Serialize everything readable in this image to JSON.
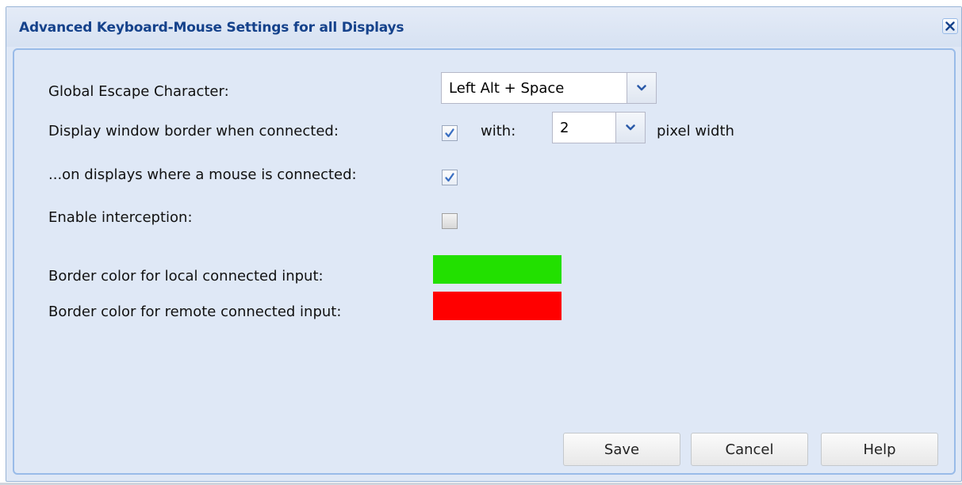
{
  "dialog": {
    "title": "Advanced Keyboard-Mouse Settings for all Displays",
    "close_icon": "close-icon"
  },
  "form": {
    "escape_label": "Global Escape Character:",
    "escape_value": "Left Alt + Space",
    "border_label": "Display window border when connected:",
    "border_checked": true,
    "with_label": "with:",
    "width_value": "2",
    "pixel_width_label": "pixel width",
    "mouse_label": "...on displays where a mouse is connected:",
    "mouse_checked": true,
    "interception_label": "Enable interception:",
    "interception_checked": false,
    "local_color_label": "Border color for local connected input:",
    "local_color": "#22e000",
    "remote_color_label": "Border color for remote connected input:",
    "remote_color": "#ff0000"
  },
  "buttons": {
    "save": "Save",
    "cancel": "Cancel",
    "help": "Help"
  },
  "colors": {
    "title": "#15428b",
    "panel_bg": "#dfe8f6",
    "panel_border": "#99bbe8",
    "check": "#3a6fc2"
  }
}
